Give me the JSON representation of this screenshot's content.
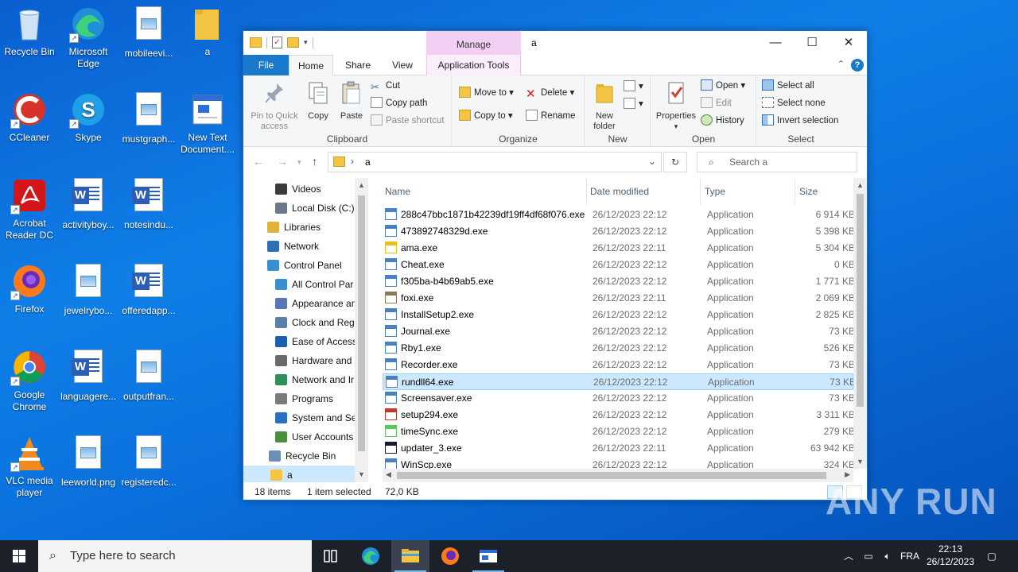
{
  "desktop": {
    "icons": [
      {
        "label": "Recycle Bin"
      },
      {
        "label": "Microsoft Edge"
      },
      {
        "label": "mobileevi..."
      },
      {
        "label": "a"
      },
      {
        "label": "CCleaner"
      },
      {
        "label": "Skype"
      },
      {
        "label": "mustgraph..."
      },
      {
        "label": "New Text Document...."
      },
      {
        "label": "Acrobat Reader DC"
      },
      {
        "label": "activityboy..."
      },
      {
        "label": "notesindu..."
      },
      {
        "label": "Firefox"
      },
      {
        "label": "jewelrybo..."
      },
      {
        "label": "offeredapp..."
      },
      {
        "label": "Google Chrome"
      },
      {
        "label": "languagere..."
      },
      {
        "label": "outputfran..."
      },
      {
        "label": "VLC media player"
      },
      {
        "label": "leeworld.png"
      },
      {
        "label": "registeredc..."
      }
    ]
  },
  "window": {
    "title": "a",
    "manage_tab": "Manage",
    "controls": {
      "minimize": "—",
      "maximize": "☐",
      "close": "✕"
    },
    "tabs": {
      "file": "File",
      "home": "Home",
      "share": "Share",
      "view": "View",
      "app_tools": "Application Tools"
    },
    "ribbon": {
      "clipboard": {
        "label": "Clipboard",
        "pin": "Pin to Quick access",
        "copy": "Copy",
        "paste": "Paste",
        "cut": "Cut",
        "copy_path": "Copy path",
        "paste_shortcut": "Paste shortcut"
      },
      "organize": {
        "label": "Organize",
        "move_to": "Move to",
        "copy_to": "Copy to",
        "delete": "Delete",
        "rename": "Rename"
      },
      "new": {
        "label": "New",
        "new_folder": "New folder"
      },
      "open": {
        "label": "Open",
        "properties": "Properties",
        "open": "Open",
        "edit": "Edit",
        "history": "History"
      },
      "select": {
        "label": "Select",
        "select_all": "Select all",
        "select_none": "Select none",
        "invert": "Invert selection"
      }
    },
    "address": {
      "crumb": "a"
    },
    "search": {
      "placeholder": "Search a"
    },
    "nav": [
      {
        "label": "Videos",
        "color": "#3a3a3a"
      },
      {
        "label": "Local Disk (C:)",
        "color": "#6b7a8a"
      },
      {
        "label": "Libraries",
        "color": "#e0b23c"
      },
      {
        "label": "Network",
        "color": "#2f6fb5"
      },
      {
        "label": "Control Panel",
        "color": "#3b8fd0"
      },
      {
        "label": "All Control Par",
        "color": "#3b8fd0"
      },
      {
        "label": "Appearance an",
        "color": "#5877b5"
      },
      {
        "label": "Clock and Regi",
        "color": "#5c7fa8"
      },
      {
        "label": "Ease of Access",
        "color": "#1d5fae"
      },
      {
        "label": "Hardware and",
        "color": "#6a6a6a"
      },
      {
        "label": "Network and Ir",
        "color": "#2f8f5a"
      },
      {
        "label": "Programs",
        "color": "#7a7a7a"
      },
      {
        "label": "System and Sec",
        "color": "#2a6fc0"
      },
      {
        "label": "User Accounts",
        "color": "#4b8f3c"
      },
      {
        "label": "Recycle Bin",
        "color": "#6e8fb5"
      },
      {
        "label": "a",
        "color": "#f4c542"
      }
    ],
    "columns": {
      "name": "Name",
      "date": "Date modified",
      "type": "Type",
      "size": "Size"
    },
    "files": [
      {
        "name": "288c47bbc1871b42239df19ff4df68f076.exe",
        "date": "26/12/2023 22:12",
        "type": "Application",
        "size": "6 914 KB",
        "icon": "#4a7fc1"
      },
      {
        "name": "473892748329d.exe",
        "date": "26/12/2023 22:12",
        "type": "Application",
        "size": "5 398 KB",
        "icon": "#4a7fc1"
      },
      {
        "name": "ama.exe",
        "date": "26/12/2023 22:11",
        "type": "Application",
        "size": "5 304 KB",
        "icon": "#e8c21a"
      },
      {
        "name": "Cheat.exe",
        "date": "26/12/2023 22:12",
        "type": "Application",
        "size": "0 KB",
        "icon": "#4a7fc1"
      },
      {
        "name": "f305ba-b4b69ab5.exe",
        "date": "26/12/2023 22:12",
        "type": "Application",
        "size": "1 771 KB",
        "icon": "#4a7fc1"
      },
      {
        "name": "foxi.exe",
        "date": "26/12/2023 22:11",
        "type": "Application",
        "size": "2 069 KB",
        "icon": "#8a7a5a"
      },
      {
        "name": "InstallSetup2.exe",
        "date": "26/12/2023 22:12",
        "type": "Application",
        "size": "2 825 KB",
        "icon": "#4a7fc1"
      },
      {
        "name": "Journal.exe",
        "date": "26/12/2023 22:12",
        "type": "Application",
        "size": "73 KB",
        "icon": "#4a7fc1"
      },
      {
        "name": "Rby1.exe",
        "date": "26/12/2023 22:12",
        "type": "Application",
        "size": "526 KB",
        "icon": "#4a7fc1"
      },
      {
        "name": "Recorder.exe",
        "date": "26/12/2023 22:12",
        "type": "Application",
        "size": "73 KB",
        "icon": "#4a7fc1"
      },
      {
        "name": "rundll64.exe",
        "date": "26/12/2023 22:12",
        "type": "Application",
        "size": "73 KB",
        "icon": "#4a7fc1",
        "selected": true
      },
      {
        "name": "Screensaver.exe",
        "date": "26/12/2023 22:12",
        "type": "Application",
        "size": "73 KB",
        "icon": "#4a7fc1"
      },
      {
        "name": "setup294.exe",
        "date": "26/12/2023 22:12",
        "type": "Application",
        "size": "3 311 KB",
        "icon": "#c0392b"
      },
      {
        "name": "timeSync.exe",
        "date": "26/12/2023 22:12",
        "type": "Application",
        "size": "279 KB",
        "icon": "#5cc45c"
      },
      {
        "name": "updater_3.exe",
        "date": "26/12/2023 22:11",
        "type": "Application",
        "size": "63 942 KB",
        "icon": "#1a1a2e"
      },
      {
        "name": "WinScp.exe",
        "date": "26/12/2023 22:12",
        "type": "Application",
        "size": "324 KB",
        "icon": "#4a7fc1"
      }
    ],
    "status": {
      "count": "18 items",
      "selection": "1 item selected",
      "size": "72,0 KB"
    }
  },
  "taskbar": {
    "search_placeholder": "Type here to search",
    "lang": "FRA",
    "time": "22:13",
    "date": "26/12/2023"
  },
  "watermark": "ANY RUN"
}
